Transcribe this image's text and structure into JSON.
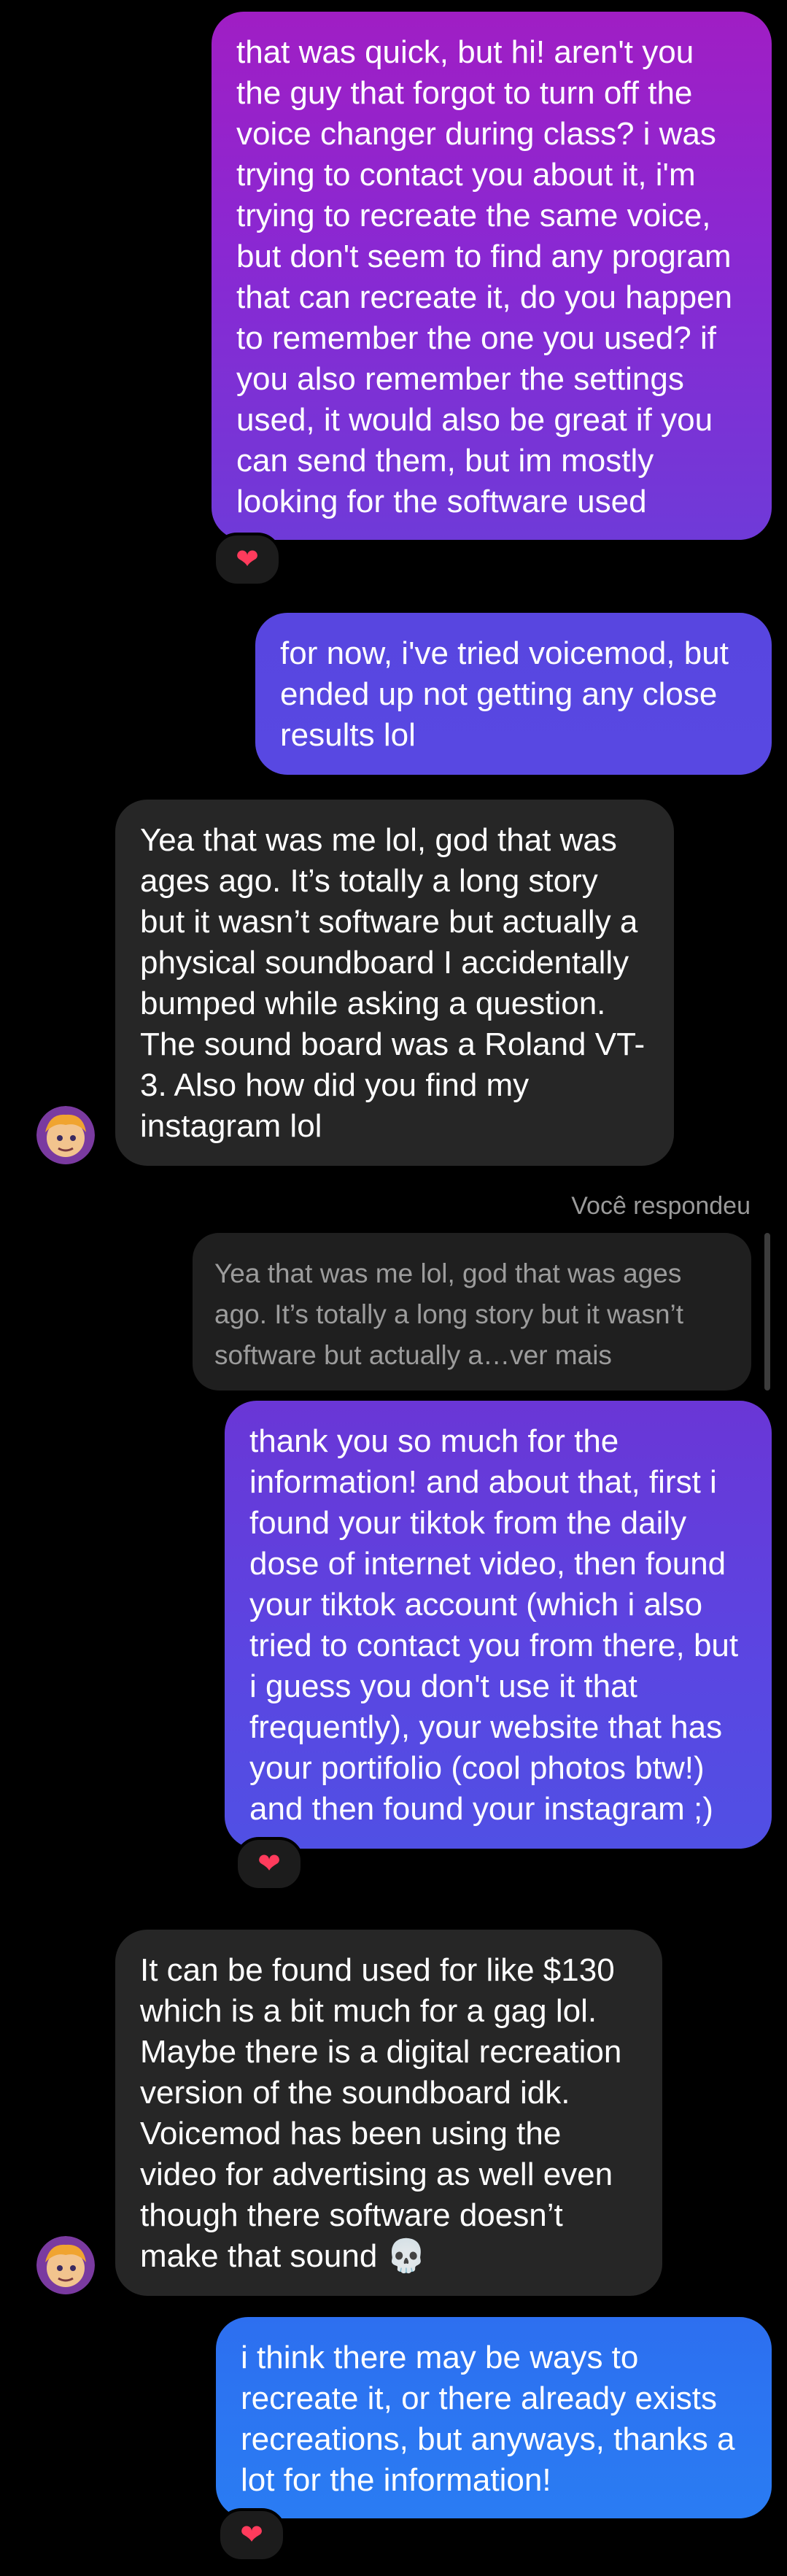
{
  "messages": {
    "m1": "that was quick, but hi! aren't you the guy that forgot to turn off the voice changer during class? i was trying to contact you about it, i'm trying to recreate the same voice, but don't seem to find any program that can recreate it, do you happen to remember the one you used? if you also remember the settings used, it would also be great if you can send them, but im mostly looking for the software used",
    "m2": "for now, i've tried voicemod, but ended up not getting any close results lol",
    "m3": "Yea that was me lol, god that was ages ago. It’s totally a long story but it wasn’t software but actually a physical soundboard I accidentally bumped while asking a question. The sound board was a Roland VT-3. Also how did you find my instagram lol",
    "m4": "thank you so much for the information! and about that, first i found your tiktok from the daily dose of internet video, then found your tiktok account (which i also tried to contact you from there, but i guess you don't use it that frequently), your website that has your portifolio (cool photos btw!) and then found your instagram ;)",
    "m5": "It can be found used for like $130 which is a bit much for a gag lol. Maybe there is a digital recreation version of the soundboard idk. Voicemod has been using the video for advertising as well even though there software doesn’t make that sound 💀",
    "m6": "i think there may be ways to recreate it, or there already exists recreations, but anyways, thanks a lot for the information!"
  },
  "reply": {
    "label": "Você respondeu",
    "quote": "Yea that was me lol, god that was ages ago. It’s totally a long story but it wasn’t software but actually a…ver mais"
  },
  "reactions": {
    "r1": "❤",
    "r2": "❤",
    "r3": "❤"
  },
  "icons": {
    "reaction": "heart-icon",
    "avatar": "avatar"
  },
  "colors": {
    "background": "#000000",
    "incoming": "#262626",
    "outgoing_blue": "#2a7cf3",
    "outgoing_purple": "#8a28d2"
  }
}
